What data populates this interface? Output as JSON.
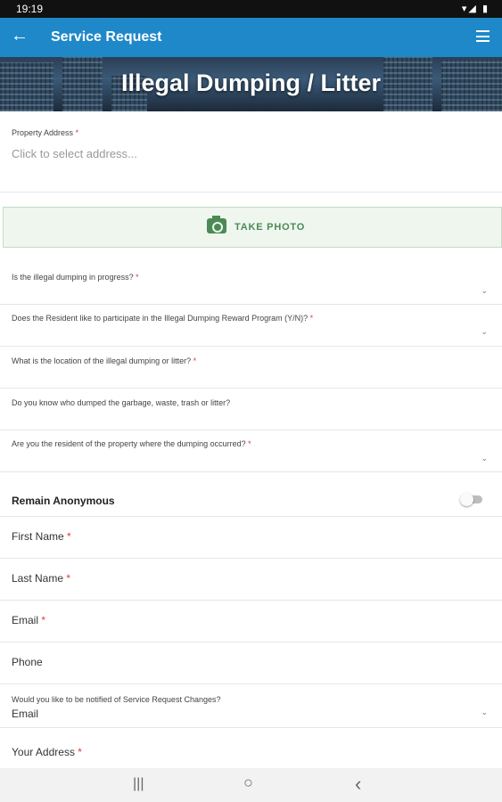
{
  "status": {
    "time": "19:19",
    "icons": "▾◢ ▮"
  },
  "appbar": {
    "title": "Service Request",
    "back_icon": "←"
  },
  "hero": {
    "title": "Illegal Dumping / Litter"
  },
  "property": {
    "label": "Property Address",
    "placeholder": "Click to select address..."
  },
  "photo": {
    "label": "TAKE PHOTO"
  },
  "questions": [
    {
      "label": "Is the illegal dumping in progress?",
      "required": "*",
      "has_dropdown": true
    },
    {
      "label": "Does the Resident like to participate in the Illegal Dumping Reward Program (Y/N)?",
      "required": "*",
      "has_dropdown": true
    },
    {
      "label": "What is the location of the illegal dumping or litter?",
      "required": "*",
      "has_dropdown": false
    },
    {
      "label": "Do you know who dumped the garbage, waste, trash or litter?",
      "required": "",
      "has_dropdown": false
    },
    {
      "label": "Are you the resident of the property where the dumping occurred?",
      "required": "*",
      "has_dropdown": true
    }
  ],
  "anonymous": {
    "label": "Remain Anonymous",
    "on": false
  },
  "contact": [
    {
      "label": "First Name",
      "required": "*"
    },
    {
      "label": "Last Name",
      "required": "*"
    },
    {
      "label": "Email",
      "required": "*"
    },
    {
      "label": "Phone",
      "required": ""
    }
  ],
  "notify": {
    "label": "Would you like to be notified of Service Request Changes?",
    "value": "Email"
  },
  "your_address": {
    "label": "Your Address",
    "required": "*"
  },
  "navbar": {
    "recents": "|||",
    "home": "○",
    "back": "‹"
  }
}
